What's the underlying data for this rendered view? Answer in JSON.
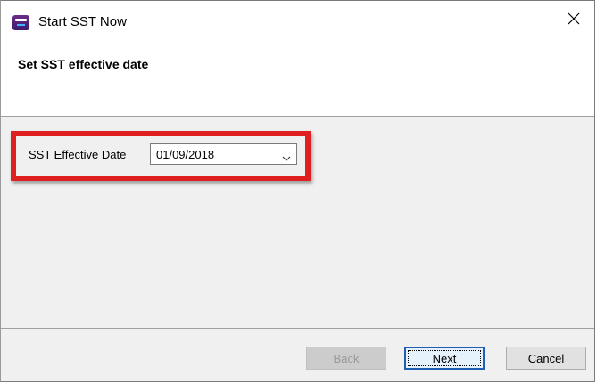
{
  "window": {
    "title": "Start SST Now",
    "icon": "app-logo-icon",
    "close_icon": "close-icon"
  },
  "header": {
    "title": "Set SST effective date"
  },
  "form": {
    "label": "SST Effective Date",
    "date_value": "01/09/2018",
    "dropdown_icon": "chevron-down-icon",
    "highlight_color": "#e02020"
  },
  "buttons": {
    "back": {
      "prefix": "",
      "mnemonic": "B",
      "rest": "ack",
      "enabled": false
    },
    "next": {
      "prefix": "",
      "mnemonic": "N",
      "rest": "ext",
      "enabled": true,
      "focused": true
    },
    "cancel": {
      "prefix": "",
      "mnemonic": "C",
      "rest": "ancel",
      "enabled": true
    }
  },
  "colors": {
    "focus_border": "#1e5fb3",
    "panel_bg": "#f0f0f0"
  }
}
